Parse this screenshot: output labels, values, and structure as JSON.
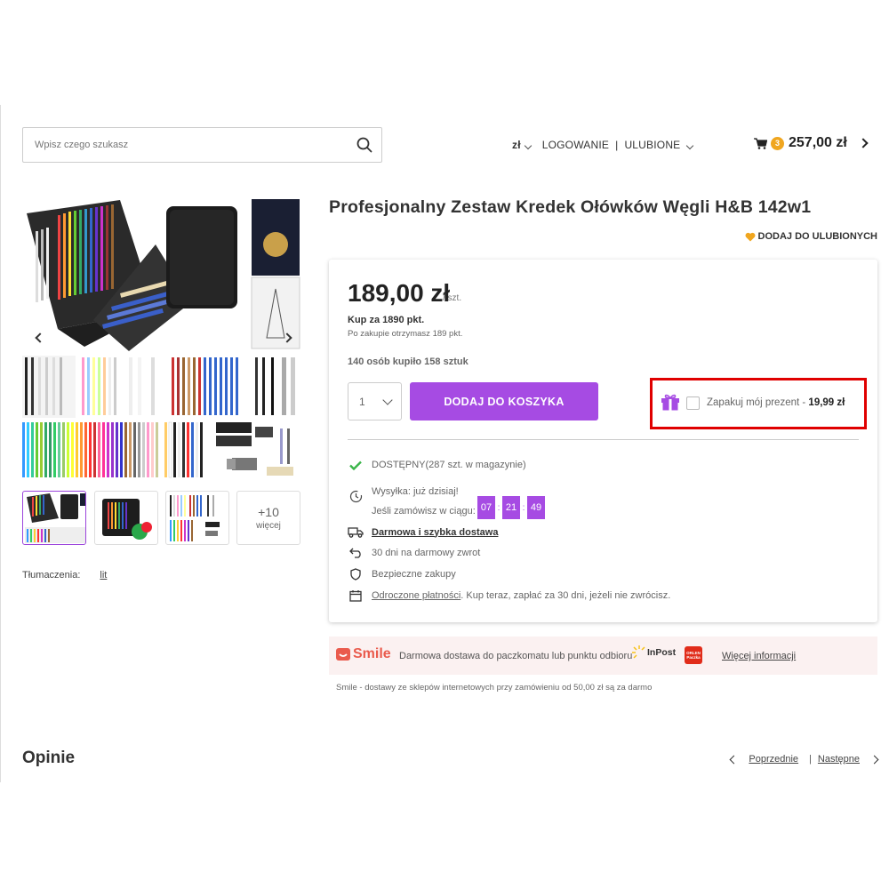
{
  "search": {
    "placeholder": "Wpisz czego szukasz"
  },
  "header": {
    "currency": "zł",
    "login": "LOGOWANIE",
    "favorites": "ULUBIONE",
    "cart_count": "3",
    "cart_total": "257,00 zł"
  },
  "gallery": {
    "more_count": "+10",
    "more_label": "więcej",
    "translations_label": "Tłumaczenia:",
    "translations_link": "lit"
  },
  "product": {
    "title": "Profesjonalny Zestaw Kredek Ołówków Węgli H&B 142w1",
    "add_to_favorites": "DODAJ DO ULUBIONYCH",
    "price": "189,00 zł",
    "price_unit": "/ szt.",
    "points_buy": "Kup za 1890 pkt.",
    "points_earn": "Po zakupie otrzymasz 189 pkt.",
    "bought_info": "140 osób kupiło 158 sztuk",
    "quantity": "1",
    "add_to_cart": "DODAJ DO KOSZYKA",
    "gift_wrap_label": "Zapakuj mój prezent - ",
    "gift_wrap_price": "19,99 zł",
    "availability": "DOSTĘPNY",
    "stock_info": " (287 szt. w magazynie)",
    "shipping_line1": "Wysyłka: już dzisiaj!",
    "shipping_line2": "Jeśli zamówisz w ciągu:",
    "timer": {
      "hours": "07",
      "minutes": "21",
      "seconds": "49"
    },
    "free_delivery": "Darmowa i szybka dostawa",
    "returns": "30 dni na darmowy zwrot",
    "secure": "Bezpieczne zakupy",
    "deferred_link": "Odroczone płatności",
    "deferred_text": ". Kup teraz, zapłać za 30 dni, jeżeli nie zwrócisz."
  },
  "smile": {
    "brand": "Smile",
    "description": "Darmowa dostawa do paczkomatu lub punktu odbioru",
    "inpost": "InPost",
    "orlen": "ORLEN Paczka",
    "more_info": "Więcej informacji",
    "note": "Smile - dostawy ze sklepów internetowych przy zamówieniu od 50,00 zł są za darmo"
  },
  "reviews": {
    "heading": "Opinie",
    "prev": "Poprzednie",
    "next": "Następne"
  },
  "colors": {
    "accent": "#a64be3",
    "highlight": "#e00000",
    "badge": "#f0a61f",
    "available": "#3bb54a"
  },
  "icons": [
    "search-icon",
    "cart-icon",
    "heart-icon",
    "gift-icon",
    "check-icon",
    "clock-icon",
    "truck-icon",
    "return-icon",
    "shield-icon",
    "calendar-icon"
  ]
}
